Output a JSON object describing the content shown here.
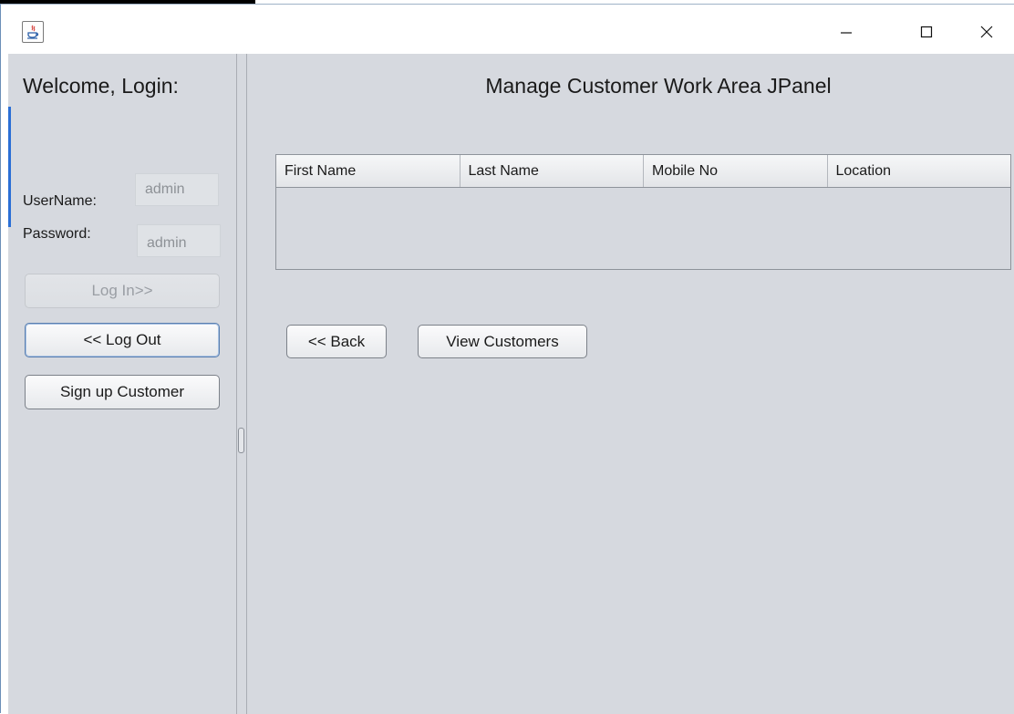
{
  "window": {
    "minimize_glyph": "—",
    "maximize_glyph": "☐",
    "close_glyph": "✕",
    "app_icon": "java-icon"
  },
  "sidebar": {
    "welcome": "Welcome, Login:",
    "username_label": "UserName:",
    "username_value": "admin",
    "password_label": "Password:",
    "password_value": "admin",
    "login_button": "Log In>>",
    "logout_button": "<< Log Out",
    "signup_button": "Sign up Customer"
  },
  "main": {
    "title": "Manage Customer Work Area JPanel",
    "table": {
      "columns": [
        "First Name",
        "Last Name",
        "Mobile No",
        "Location"
      ],
      "rows": []
    },
    "back_button": "<< Back",
    "view_button": "View Customers"
  },
  "colors": {
    "panel_bg": "#d6d9df",
    "accent": "#2a6fd6"
  }
}
